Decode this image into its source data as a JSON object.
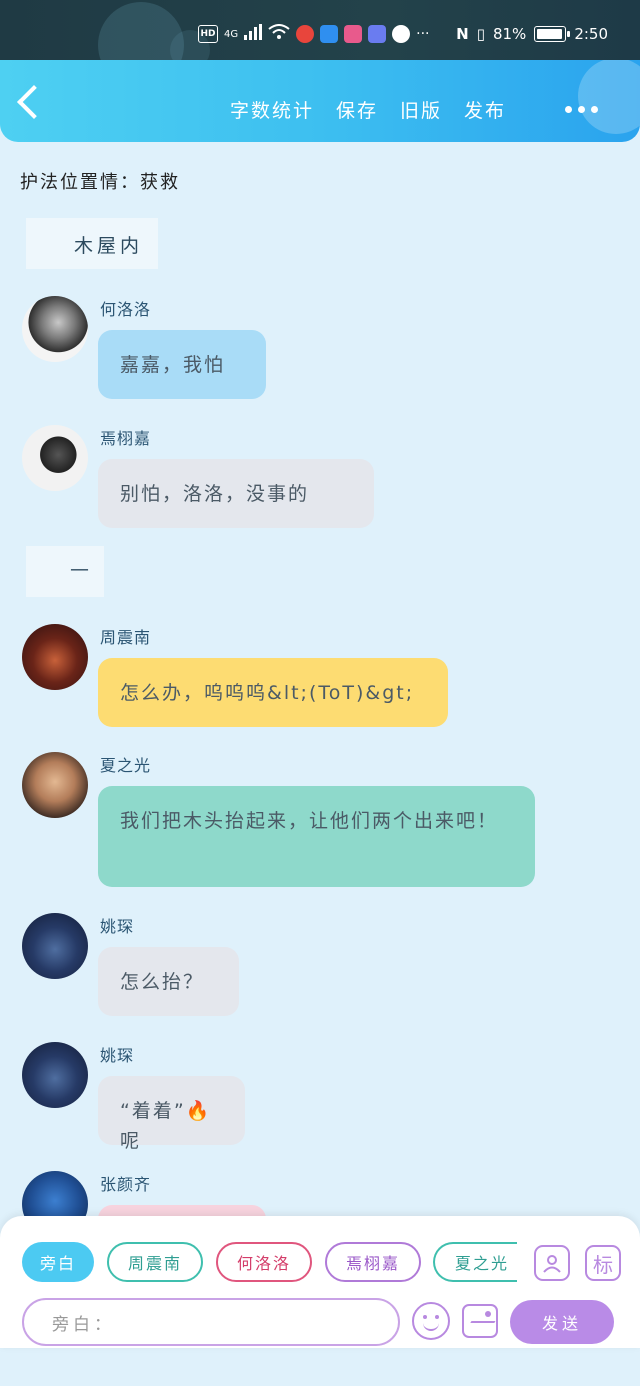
{
  "status_bar": {
    "network": "4G",
    "hd_label": "HD",
    "battery_percent": "81%",
    "battery_level": 0.81,
    "time": "2:50"
  },
  "header": {
    "actions": [
      "字数统计",
      "保存",
      "旧版",
      "发布"
    ],
    "more_icon": "more-dots-icon"
  },
  "story": {
    "subtitle": "护法位置情：获救",
    "scenes": [
      "木屋内",
      "—"
    ]
  },
  "messages": [
    {
      "name": "何洛洛",
      "text": "嘉嘉，我怕",
      "bubble_color": "#a9dcf7"
    },
    {
      "name": "焉栩嘉",
      "text": "别怕，洛洛，没事的",
      "bubble_color": "#e4e7ed"
    },
    {
      "name": "周震南",
      "text": "怎么办，呜呜呜&lt;(ToT)&gt;",
      "bubble_color": "#fddc72"
    },
    {
      "name": "夏之光",
      "text": "我们把木头抬起来，让他们两个出来吧！",
      "bubble_color": "#8ed9cb"
    },
    {
      "name": "姚琛",
      "text": "怎么抬？",
      "bubble_color": "#e4e7ed"
    },
    {
      "name": "姚琛",
      "text": "“着着”🔥呢",
      "bubble_color": "#e4e7ed"
    },
    {
      "name": "张颜齐",
      "text": "",
      "bubble_color": "#f7d3de"
    }
  ],
  "composer": {
    "roles": [
      "旁白",
      "周震南",
      "何洛洛",
      "焉栩嘉",
      "夏之光"
    ],
    "role_colors": [
      "#4ccaf2",
      "#3fbfae",
      "#e0567e",
      "#b07ad8",
      "#3fbfae"
    ],
    "tool_person_icon": "person-card-icon",
    "tool_biao_label": "标",
    "input_placeholder": "旁白：",
    "emoji_icon": "smile-icon",
    "image_icon": "image-icon",
    "send_label": "发送"
  }
}
